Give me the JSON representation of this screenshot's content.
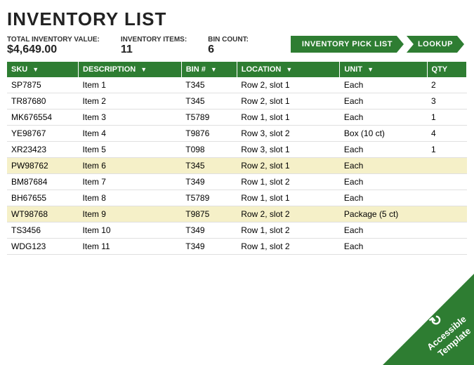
{
  "page": {
    "title": "INVENTORY LIST"
  },
  "summary": {
    "total_value_label": "TOTAL INVENTORY VALUE:",
    "total_value": "$4,649.00",
    "items_label": "INVENTORY ITEMS:",
    "items_count": "11",
    "bin_label": "BIN COUNT:",
    "bin_count": "6"
  },
  "actions": [
    {
      "id": "pick-list",
      "label": "INVENTORY PICK LIST"
    },
    {
      "id": "lookup",
      "label": "LOOKUP"
    }
  ],
  "table": {
    "headers": [
      {
        "id": "sku",
        "label": "SKU"
      },
      {
        "id": "description",
        "label": "DESCRIPTION"
      },
      {
        "id": "bin",
        "label": "BIN #"
      },
      {
        "id": "location",
        "label": "LOCATION"
      },
      {
        "id": "unit",
        "label": "UNIT"
      },
      {
        "id": "qty",
        "label": "QTY"
      }
    ],
    "rows": [
      {
        "sku": "SP7875",
        "description": "Item 1",
        "bin": "T345",
        "location": "Row 2, slot 1",
        "unit": "Each",
        "qty": "2",
        "highlighted": false
      },
      {
        "sku": "TR87680",
        "description": "Item 2",
        "bin": "T345",
        "location": "Row 2, slot 1",
        "unit": "Each",
        "qty": "3",
        "highlighted": false
      },
      {
        "sku": "MK676554",
        "description": "Item 3",
        "bin": "T5789",
        "location": "Row 1, slot 1",
        "unit": "Each",
        "qty": "1",
        "highlighted": false
      },
      {
        "sku": "YE98767",
        "description": "Item 4",
        "bin": "T9876",
        "location": "Row 3, slot 2",
        "unit": "Box (10 ct)",
        "qty": "4",
        "highlighted": false
      },
      {
        "sku": "XR23423",
        "description": "Item 5",
        "bin": "T098",
        "location": "Row 3, slot 1",
        "unit": "Each",
        "qty": "1",
        "highlighted": false
      },
      {
        "sku": "PW98762",
        "description": "Item 6",
        "bin": "T345",
        "location": "Row 2, slot 1",
        "unit": "Each",
        "qty": "",
        "highlighted": true
      },
      {
        "sku": "BM87684",
        "description": "Item 7",
        "bin": "T349",
        "location": "Row 1, slot 2",
        "unit": "Each",
        "qty": "",
        "highlighted": false
      },
      {
        "sku": "BH67655",
        "description": "Item 8",
        "bin": "T5789",
        "location": "Row 1, slot 1",
        "unit": "Each",
        "qty": "",
        "highlighted": false
      },
      {
        "sku": "WT98768",
        "description": "Item 9",
        "bin": "T9875",
        "location": "Row 2, slot 2",
        "unit": "Package (5 ct)",
        "qty": "",
        "highlighted": true
      },
      {
        "sku": "TS3456",
        "description": "Item 10",
        "bin": "T349",
        "location": "Row 1, slot 2",
        "unit": "Each",
        "qty": "",
        "highlighted": false
      },
      {
        "sku": "WDG123",
        "description": "Item 11",
        "bin": "T349",
        "location": "Row 1, slot 2",
        "unit": "Each",
        "qty": "",
        "highlighted": false
      }
    ]
  },
  "badge": {
    "icon": "↻",
    "line1": "Accessible",
    "line2": "Template"
  }
}
